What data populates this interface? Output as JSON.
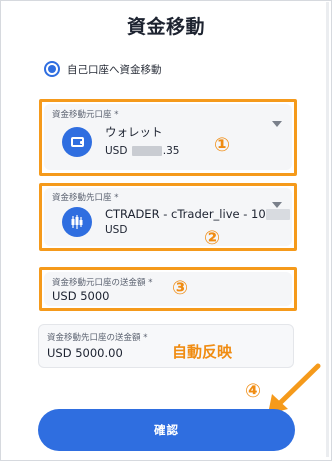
{
  "header": {
    "title": "資金移動"
  },
  "radio": {
    "label": "自己口座へ資金移動",
    "selected": true
  },
  "source_account": {
    "label": "資金移動元口座 *",
    "name": "ウォレット",
    "currency": "USD",
    "balance_suffix": ".35",
    "icon": "wallet-icon"
  },
  "destination_account": {
    "label": "資金移動先口座 *",
    "name": "CTRADER - cTrader_live - 10",
    "currency": "USD",
    "icon": "candlestick-icon"
  },
  "send_amount": {
    "label": "資金移動元口座の送金額 *",
    "value": "USD 5000"
  },
  "receive_amount": {
    "label": "資金移動先口座の送金額 *",
    "value": "USD 5000.00"
  },
  "annotations": {
    "n1": "①",
    "n2": "②",
    "n3": "③",
    "n4": "④",
    "auto": "自動反映",
    "color": "#f59a1b"
  },
  "actions": {
    "confirm_label": "確認"
  },
  "colors": {
    "accent": "#2f6ee0",
    "field_bg": "#f5f6f8"
  }
}
